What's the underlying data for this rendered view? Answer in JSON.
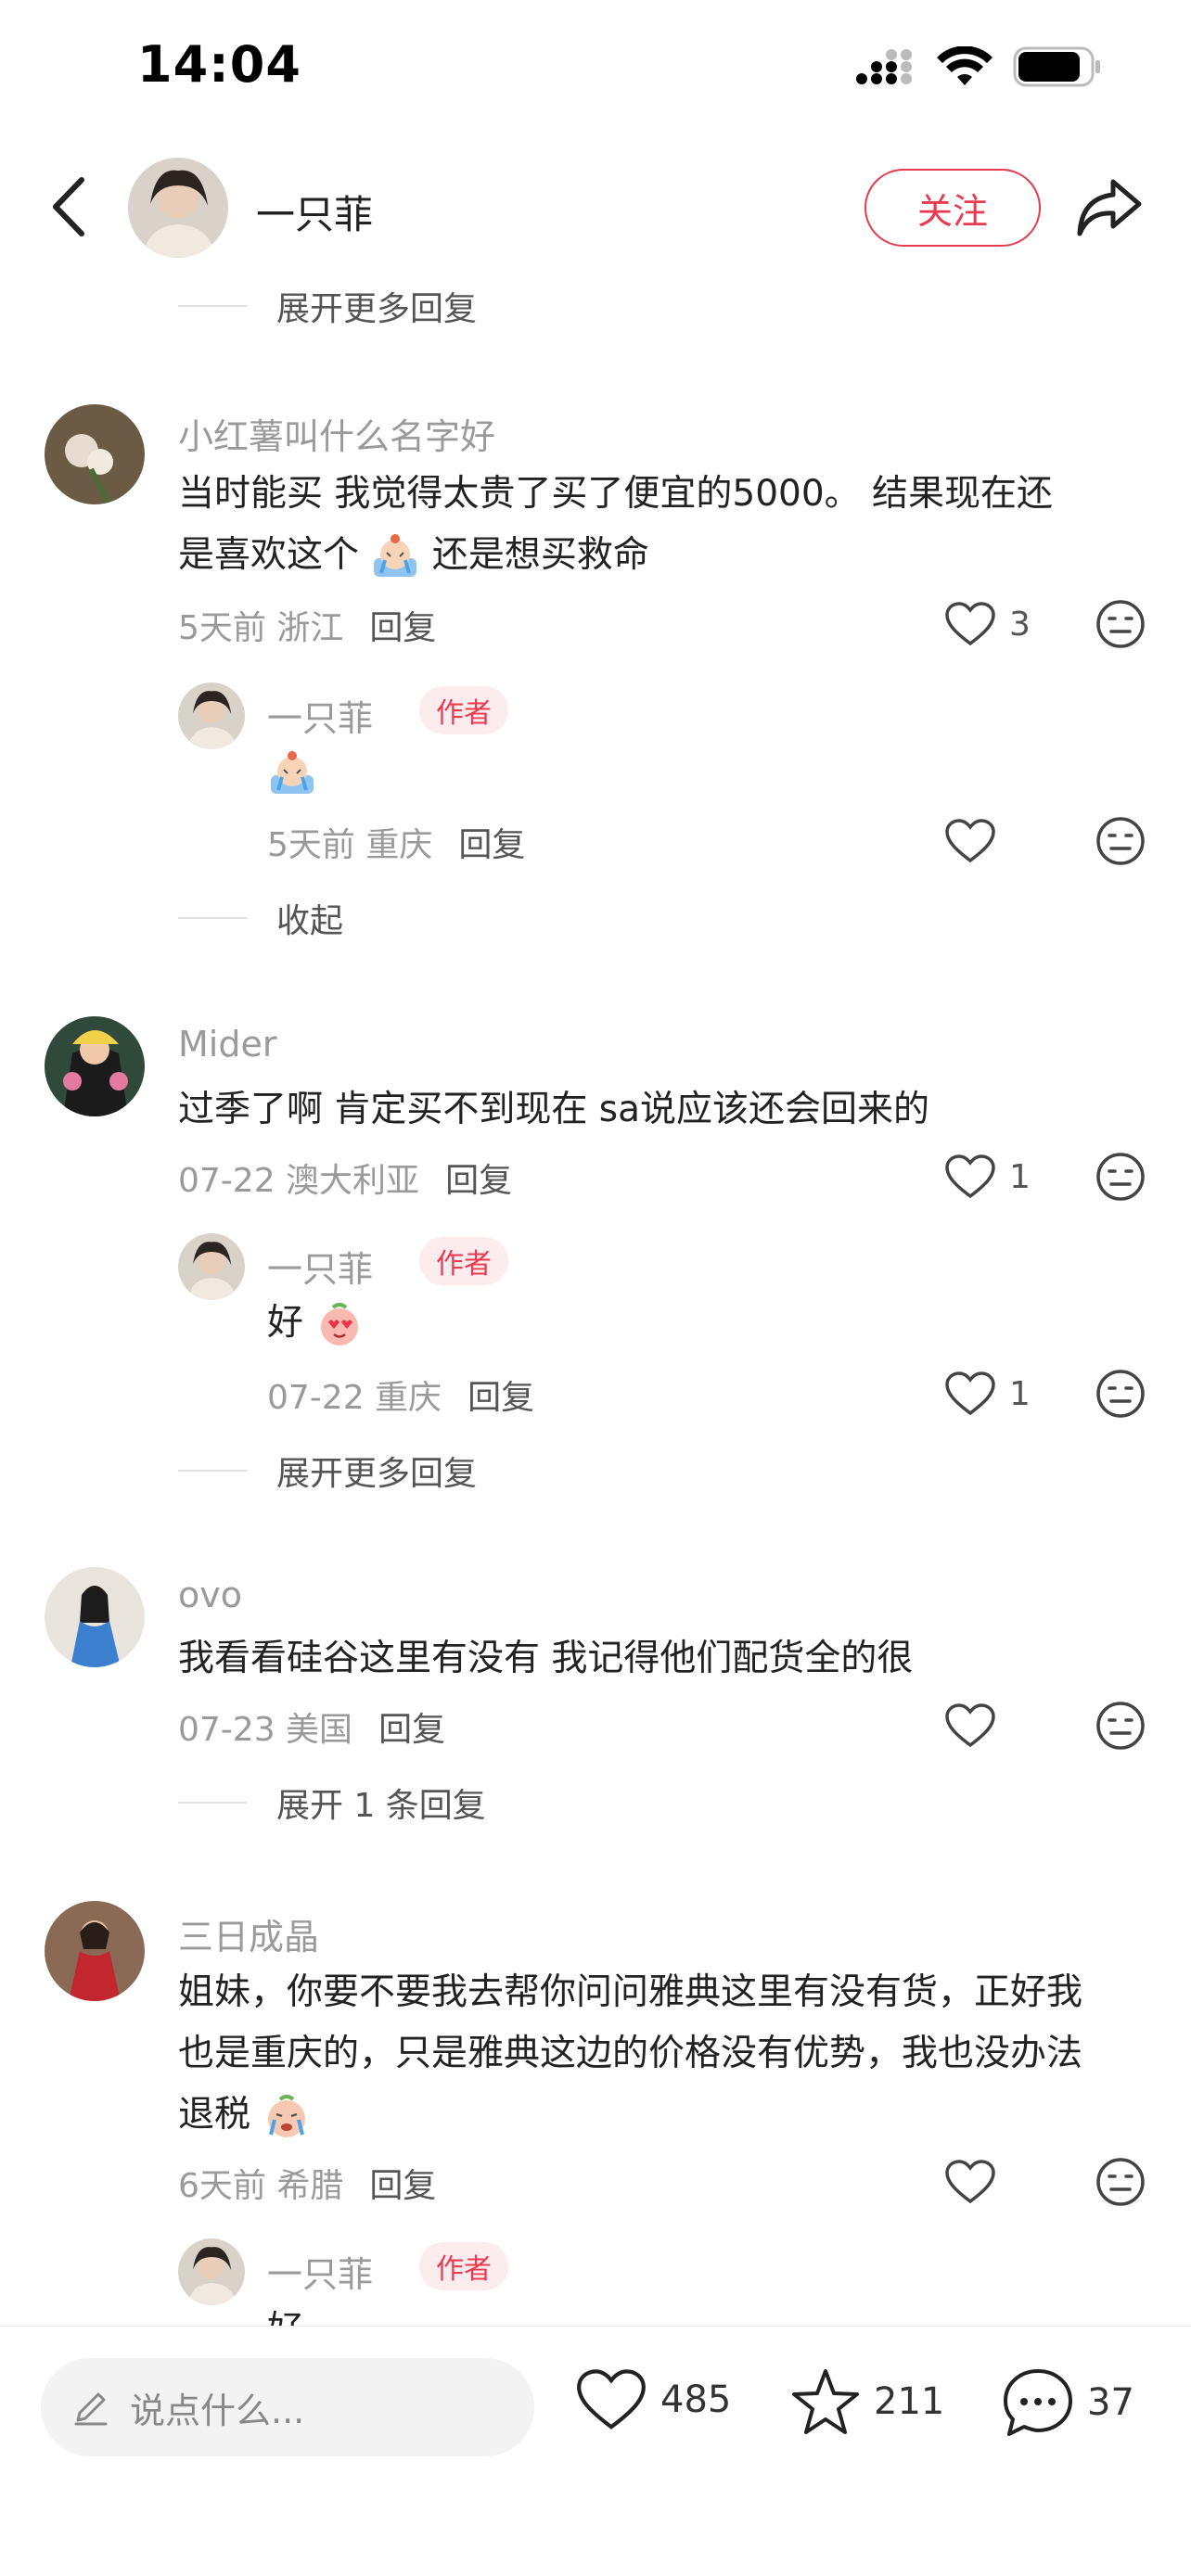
{
  "status": {
    "time": "14:04"
  },
  "header": {
    "name": "一只菲",
    "follow_label": "关注"
  },
  "top_expand": "展开更多回复",
  "comments": [
    {
      "user": "小红薯叫什么名字好",
      "text1": "当时能买 我觉得太贵了买了便宜的5000。 结果现在还",
      "text2a": "是喜欢这个",
      "text2b": "还是想买救命",
      "meta": "5天前 浙江",
      "reply_label": "回复",
      "likes": "3",
      "reply": {
        "user": "一只菲",
        "tag": "作者",
        "meta": "5天前 重庆",
        "reply_label": "回复"
      },
      "toggle": "收起"
    },
    {
      "user": "Mider",
      "text1": "过季了啊 肯定买不到现在  sa说应该还会回来的",
      "meta": "07-22 澳大利亚",
      "reply_label": "回复",
      "likes": "1",
      "reply": {
        "user": "一只菲",
        "tag": "作者",
        "text": "好",
        "meta": "07-22 重庆",
        "reply_label": "回复",
        "likes": "1"
      },
      "toggle": "展开更多回复"
    },
    {
      "user": "ovo",
      "text1": "我看看硅谷这里有没有 我记得他们配货全的很",
      "meta": "07-23 美国",
      "reply_label": "回复",
      "toggle": "展开 1 条回复"
    },
    {
      "user": "三日成晶",
      "text1": "姐妹，你要不要我去帮你问问雅典这里有没有货，正好我",
      "text2": "也是重庆的，只是雅典这边的价格没有优势，我也没办法",
      "text3": "退税",
      "meta": "6天前 希腊",
      "reply_label": "回复",
      "reply": {
        "user": "一只菲",
        "tag": "作者",
        "text": "好"
      }
    }
  ],
  "bottom": {
    "input_placeholder": "说点什么...",
    "likes": "485",
    "stars": "211",
    "comments": "37"
  },
  "colors": {
    "accent": "#e83a50",
    "muted": "#9a9a9a"
  }
}
